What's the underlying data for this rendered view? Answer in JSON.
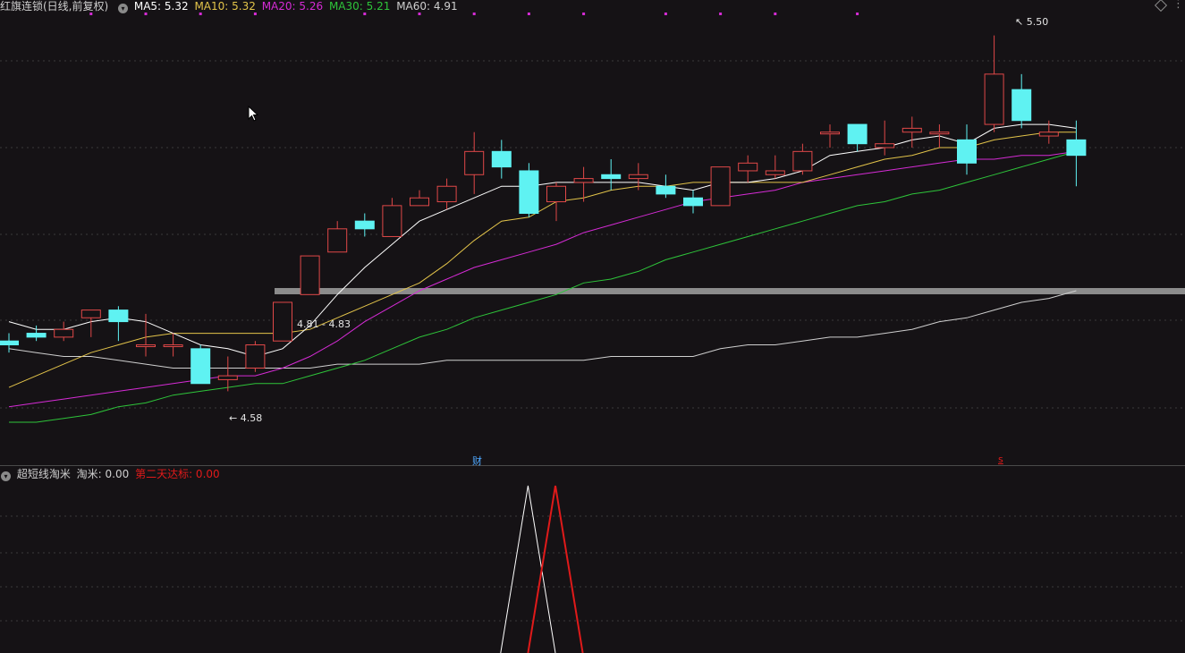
{
  "main_header": {
    "title": "红旗连锁(日线,前复权)",
    "ma": [
      {
        "label": "MA5: 5.32",
        "color": "#ffffff"
      },
      {
        "label": "MA10: 5.32",
        "color": "#e3c44a"
      },
      {
        "label": "MA20: 5.26",
        "color": "#d52bd5"
      },
      {
        "label": "MA30: 5.21",
        "color": "#2ec43a"
      },
      {
        "label": "MA60: 4.91",
        "color": "#cfcfcf"
      }
    ]
  },
  "sub_header": {
    "title": "超短线淘米",
    "value1": "淘米: 0.00",
    "value2": "第二天达标: 0.00",
    "value2_color": "#e01a1a"
  },
  "annotations": {
    "high": "5.50",
    "low": "4.58",
    "range": "4.81 - 4.83",
    "marker_cai": "财",
    "marker_s": "s"
  },
  "colors": {
    "up": "#e04848",
    "down": "#5ff2f2",
    "ma5": "#ffffff",
    "ma10": "#e3c44a",
    "ma20": "#d52bd5",
    "ma30": "#2ec43a",
    "ma60": "#cfcfcf",
    "band": "#8c8c8c"
  },
  "icons": [
    "collapse-icon",
    "diamond-icon",
    "more-dots-icon",
    "mouse-cursor-icon"
  ],
  "chart_data": {
    "type": "candlestick",
    "price_range": [
      4.5,
      5.55
    ],
    "candles": [
      {
        "o": 4.71,
        "h": 4.73,
        "l": 4.68,
        "c": 4.7
      },
      {
        "o": 4.73,
        "h": 4.75,
        "l": 4.71,
        "c": 4.72
      },
      {
        "o": 4.72,
        "h": 4.76,
        "l": 4.71,
        "c": 4.74
      },
      {
        "o": 4.77,
        "h": 4.79,
        "l": 4.72,
        "c": 4.79
      },
      {
        "o": 4.79,
        "h": 4.8,
        "l": 4.71,
        "c": 4.76
      },
      {
        "o": 4.7,
        "h": 4.78,
        "l": 4.67,
        "c": 4.7
      },
      {
        "o": 4.7,
        "h": 4.73,
        "l": 4.67,
        "c": 4.7
      },
      {
        "o": 4.69,
        "h": 4.7,
        "l": 4.63,
        "c": 4.6
      },
      {
        "o": 4.61,
        "h": 4.67,
        "l": 4.58,
        "c": 4.62
      },
      {
        "o": 4.64,
        "h": 4.71,
        "l": 4.63,
        "c": 4.7
      },
      {
        "o": 4.71,
        "h": 4.81,
        "l": 4.71,
        "c": 4.81
      },
      {
        "o": 4.83,
        "h": 4.93,
        "l": 4.83,
        "c": 4.93
      },
      {
        "o": 4.94,
        "h": 5.02,
        "l": 4.94,
        "c": 5.0
      },
      {
        "o": 5.02,
        "h": 5.04,
        "l": 4.98,
        "c": 5.0
      },
      {
        "o": 4.98,
        "h": 5.08,
        "l": 4.98,
        "c": 5.06
      },
      {
        "o": 5.06,
        "h": 5.1,
        "l": 5.06,
        "c": 5.08
      },
      {
        "o": 5.07,
        "h": 5.13,
        "l": 5.05,
        "c": 5.11
      },
      {
        "o": 5.14,
        "h": 5.25,
        "l": 5.09,
        "c": 5.2
      },
      {
        "o": 5.2,
        "h": 5.23,
        "l": 5.13,
        "c": 5.16
      },
      {
        "o": 5.15,
        "h": 5.17,
        "l": 5.03,
        "c": 5.04
      },
      {
        "o": 5.07,
        "h": 5.12,
        "l": 5.02,
        "c": 5.11
      },
      {
        "o": 5.12,
        "h": 5.16,
        "l": 5.07,
        "c": 5.13
      },
      {
        "o": 5.14,
        "h": 5.18,
        "l": 5.1,
        "c": 5.13
      },
      {
        "o": 5.13,
        "h": 5.17,
        "l": 5.1,
        "c": 5.14
      },
      {
        "o": 5.11,
        "h": 5.14,
        "l": 5.08,
        "c": 5.09
      },
      {
        "o": 5.08,
        "h": 5.1,
        "l": 5.04,
        "c": 5.06
      },
      {
        "o": 5.06,
        "h": 5.16,
        "l": 5.06,
        "c": 5.16
      },
      {
        "o": 5.15,
        "h": 5.19,
        "l": 5.12,
        "c": 5.17
      },
      {
        "o": 5.14,
        "h": 5.19,
        "l": 5.13,
        "c": 5.15
      },
      {
        "o": 5.15,
        "h": 5.22,
        "l": 5.14,
        "c": 5.2
      },
      {
        "o": 5.25,
        "h": 5.27,
        "l": 5.21,
        "c": 5.25
      },
      {
        "o": 5.27,
        "h": 5.27,
        "l": 5.2,
        "c": 5.22
      },
      {
        "o": 5.21,
        "h": 5.28,
        "l": 5.19,
        "c": 5.22
      },
      {
        "o": 5.25,
        "h": 5.29,
        "l": 5.21,
        "c": 5.26
      },
      {
        "o": 5.25,
        "h": 5.27,
        "l": 5.21,
        "c": 5.25
      },
      {
        "o": 5.23,
        "h": 5.27,
        "l": 5.14,
        "c": 5.17
      },
      {
        "o": 5.27,
        "h": 5.5,
        "l": 5.25,
        "c": 5.4
      },
      {
        "o": 5.36,
        "h": 5.4,
        "l": 5.26,
        "c": 5.28
      },
      {
        "o": 5.24,
        "h": 5.28,
        "l": 5.22,
        "c": 5.25
      },
      {
        "o": 5.23,
        "h": 5.28,
        "l": 5.11,
        "c": 5.19
      }
    ],
    "ma5": [
      4.76,
      4.74,
      4.74,
      4.76,
      4.77,
      4.76,
      4.73,
      4.7,
      4.69,
      4.67,
      4.69,
      4.75,
      4.83,
      4.9,
      4.96,
      5.02,
      5.05,
      5.08,
      5.11,
      5.11,
      5.12,
      5.12,
      5.12,
      5.12,
      5.11,
      5.1,
      5.12,
      5.12,
      5.13,
      5.15,
      5.19,
      5.2,
      5.21,
      5.23,
      5.24,
      5.22,
      5.26,
      5.27,
      5.27,
      5.26
    ],
    "ma10": [
      4.59,
      4.62,
      4.65,
      4.68,
      4.7,
      4.72,
      4.73,
      4.73,
      4.73,
      4.73,
      4.73,
      4.74,
      4.77,
      4.8,
      4.83,
      4.86,
      4.91,
      4.97,
      5.02,
      5.03,
      5.07,
      5.08,
      5.1,
      5.11,
      5.11,
      5.12,
      5.12,
      5.12,
      5.12,
      5.12,
      5.14,
      5.16,
      5.18,
      5.19,
      5.21,
      5.21,
      5.23,
      5.24,
      5.25,
      5.25
    ],
    "ma20": [
      4.54,
      4.55,
      4.56,
      4.57,
      4.58,
      4.59,
      4.6,
      4.61,
      4.62,
      4.62,
      4.64,
      4.67,
      4.71,
      4.76,
      4.8,
      4.84,
      4.87,
      4.9,
      4.92,
      4.94,
      4.96,
      4.99,
      5.01,
      5.03,
      5.05,
      5.07,
      5.08,
      5.09,
      5.1,
      5.12,
      5.13,
      5.14,
      5.15,
      5.16,
      5.17,
      5.18,
      5.18,
      5.19,
      5.19,
      5.2
    ],
    "ma30": [
      4.5,
      4.5,
      4.51,
      4.52,
      4.54,
      4.55,
      4.57,
      4.58,
      4.59,
      4.6,
      4.6,
      4.62,
      4.64,
      4.66,
      4.69,
      4.72,
      4.74,
      4.77,
      4.79,
      4.81,
      4.83,
      4.86,
      4.87,
      4.89,
      4.92,
      4.94,
      4.96,
      4.98,
      5.0,
      5.02,
      5.04,
      5.06,
      5.07,
      5.09,
      5.1,
      5.12,
      5.14,
      5.16,
      5.18,
      5.2
    ],
    "ma60": [
      4.69,
      4.68,
      4.67,
      4.67,
      4.66,
      4.65,
      4.64,
      4.64,
      4.64,
      4.64,
      4.64,
      4.64,
      4.65,
      4.65,
      4.65,
      4.65,
      4.66,
      4.66,
      4.66,
      4.66,
      4.66,
      4.66,
      4.67,
      4.67,
      4.67,
      4.67,
      4.69,
      4.7,
      4.7,
      4.71,
      4.72,
      4.72,
      4.73,
      4.74,
      4.76,
      4.77,
      4.79,
      4.81,
      4.82,
      4.84
    ],
    "marker_dot_candles": [
      3,
      5,
      7,
      9,
      13,
      15,
      17,
      19,
      21,
      24,
      26,
      28,
      31
    ],
    "band": {
      "from_candle": 10,
      "value": 4.84
    },
    "indicator": {
      "taomi": {
        "peak_candle": 19,
        "value": 1,
        "color": "#ffffff"
      },
      "second": {
        "peak_candle": 20,
        "value": 1,
        "color": "#e01a1a"
      }
    }
  }
}
